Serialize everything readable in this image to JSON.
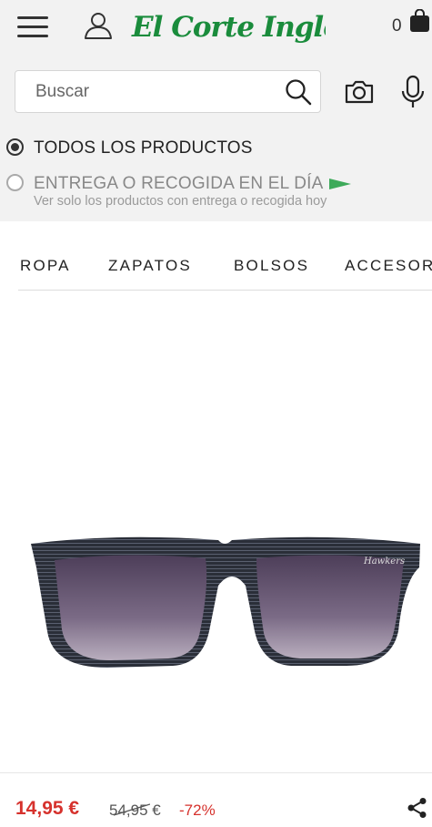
{
  "header": {
    "brand": "El Corte Inglés",
    "cart_count": "0",
    "icons": {
      "menu": "hamburger-menu-icon",
      "user": "user-icon",
      "cart": "shopping-bag-icon",
      "search": "search-icon",
      "camera": "camera-icon",
      "mic": "microphone-icon"
    },
    "brand_color": "#1a8c3c"
  },
  "search": {
    "placeholder": "Buscar",
    "value": ""
  },
  "filters": {
    "options": [
      {
        "label": "TODOS LOS PRODUCTOS",
        "selected": true
      },
      {
        "label": "ENTREGA O RECOGIDA EN EL DÍA",
        "selected": false,
        "subtitle": "Ver solo los productos con entrega o recogida hoy"
      }
    ]
  },
  "categories": [
    "ROPA",
    "ZAPATOS",
    "BOLSOS",
    "ACCESORIOS"
  ],
  "product": {
    "image": "sunglasses",
    "price_now": "14,95 €",
    "price_old": "54,95 €",
    "discount": "-72%",
    "share_icon": "share-icon",
    "accent_color": "#d6322d"
  }
}
